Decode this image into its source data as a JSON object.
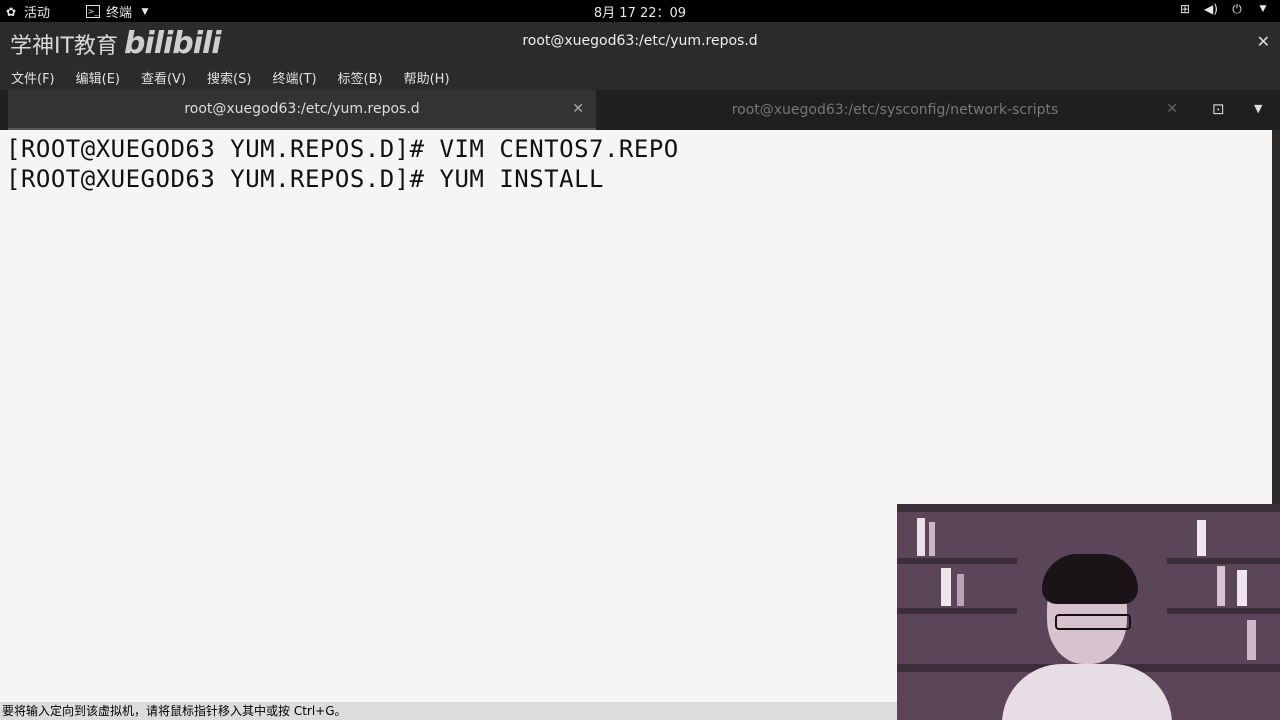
{
  "topbar": {
    "activities": "活动",
    "app_menu": "终端",
    "clock": "8月 17  22：09"
  },
  "window": {
    "brand_text": "学神IT教育",
    "brand_logo": "bilibili",
    "title": "root@xuegod63:/etc/yum.repos.d"
  },
  "menu": [
    "文件(F)",
    "编辑(E)",
    "查看(V)",
    "搜索(S)",
    "终端(T)",
    "标签(B)",
    "帮助(H)"
  ],
  "tabs": [
    {
      "label": "root@xuegod63:/etc/yum.repos.d",
      "active": true
    },
    {
      "label": "root@xuegod63:/etc/sysconfig/network-scripts",
      "active": false
    }
  ],
  "terminal": {
    "lines": [
      "[ROOT@XUEGOD63 YUM.REPOS.D]# VIM CENTOS7.REPO",
      "[ROOT@XUEGOD63 YUM.REPOS.D]# YUM INSTALL"
    ]
  },
  "statusbar": "要将输入定向到该虚拟机，请将鼠标指针移入其中或按 Ctrl+G。",
  "icons": {
    "activities": "gnome-foot-icon",
    "app": "terminal-icon",
    "network": "network-icon",
    "volume": "volume-icon",
    "power": "power-icon",
    "close": "close-icon",
    "new_tab": "new-tab-icon",
    "dropdown": "chevron-down-icon"
  },
  "colors": {
    "terminal_bg": "#f6f5f4",
    "chrome_bg": "#2b2b2b"
  }
}
